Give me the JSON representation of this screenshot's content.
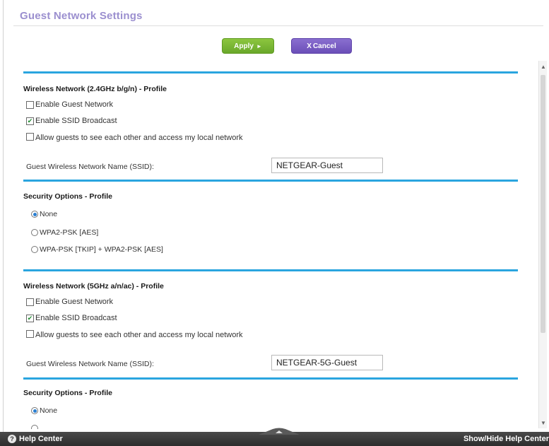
{
  "page": {
    "title": "Guest Network Settings"
  },
  "toolbar": {
    "apply_label": "Apply",
    "apply_arrow": "►",
    "cancel_x": "X",
    "cancel_label": "Cancel"
  },
  "wireless_24": {
    "title": "Wireless Network (2.4GHz b/g/n) - Profile",
    "enable_guest_label": "Enable Guest Network",
    "enable_guest_checked": false,
    "ssid_broadcast_label": "Enable SSID Broadcast",
    "ssid_broadcast_checked": true,
    "allow_guests_label": "Allow guests to see each other and access my local network",
    "allow_guests_checked": false,
    "ssid_label": "Guest Wireless Network Name (SSID):",
    "ssid_value": "NETGEAR-Guest"
  },
  "security_24": {
    "title": "Security Options - Profile",
    "options": [
      "None",
      "WPA2-PSK [AES]",
      "WPA-PSK [TKIP] + WPA2-PSK [AES]"
    ],
    "selected": "None"
  },
  "wireless_5": {
    "title": "Wireless Network (5GHz a/n/ac) - Profile",
    "enable_guest_label": "Enable Guest Network",
    "enable_guest_checked": false,
    "ssid_broadcast_label": "Enable SSID Broadcast",
    "ssid_broadcast_checked": true,
    "allow_guests_label": "Allow guests to see each other and access my local network",
    "allow_guests_checked": false,
    "ssid_label": "Guest Wireless Network Name (SSID):",
    "ssid_value": "NETGEAR-5G-Guest"
  },
  "security_5": {
    "title": "Security Options - Profile",
    "options": [
      "None"
    ],
    "selected": "None"
  },
  "footer": {
    "help_label": "Help Center",
    "toggle_label": "Show/Hide Help Center"
  },
  "icons": {
    "help": "question-circle-icon",
    "check": "checkmark-icon"
  },
  "colors": {
    "title": "#9b8fcf",
    "apply": "#7bb934",
    "cancel": "#7a5fc4",
    "rule": "#2aa5df",
    "footer": "#3a3a3a"
  }
}
